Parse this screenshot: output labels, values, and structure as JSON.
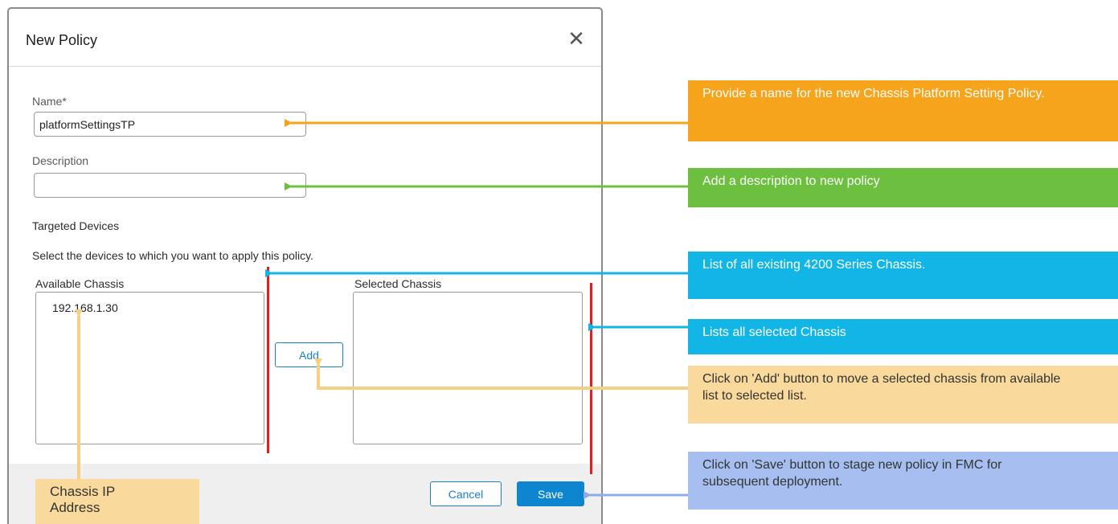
{
  "dialog": {
    "title": "New Policy",
    "close_glyph": "✕",
    "name_label": "Name*",
    "name_value": "platformSettingsTP",
    "description_label": "Description",
    "description_value": "",
    "targeted_heading": "Targeted Devices",
    "targeted_help": "Select the devices to which you want to apply this policy.",
    "available_label": "Available Chassis",
    "available_items": [
      "192.168.1.30"
    ],
    "selected_label": "Selected Chassis",
    "selected_items": [],
    "add_label": "Add",
    "cancel_label": "Cancel",
    "save_label": "Save"
  },
  "annotations": {
    "name": "Provide a name for the new Chassis Platform Setting Policy.",
    "description": "Add a description to new policy",
    "available": "List of all existing 4200 Series Chassis.",
    "selected": "Lists all selected Chassis",
    "add": "Click on 'Add' button to move a selected chassis from available list to selected list.",
    "save": "Click on 'Save' button to stage new policy in FMC for subsequent deployment.",
    "chassis_ip": "Chassis IP Address"
  },
  "colors": {
    "orange": "#f5a41c",
    "green": "#6cbf3f",
    "cyan": "#11b6e6",
    "peach": "#fad99c",
    "lavender": "#a6bff0",
    "red": "#e02020",
    "accent": "#0d86cf"
  }
}
